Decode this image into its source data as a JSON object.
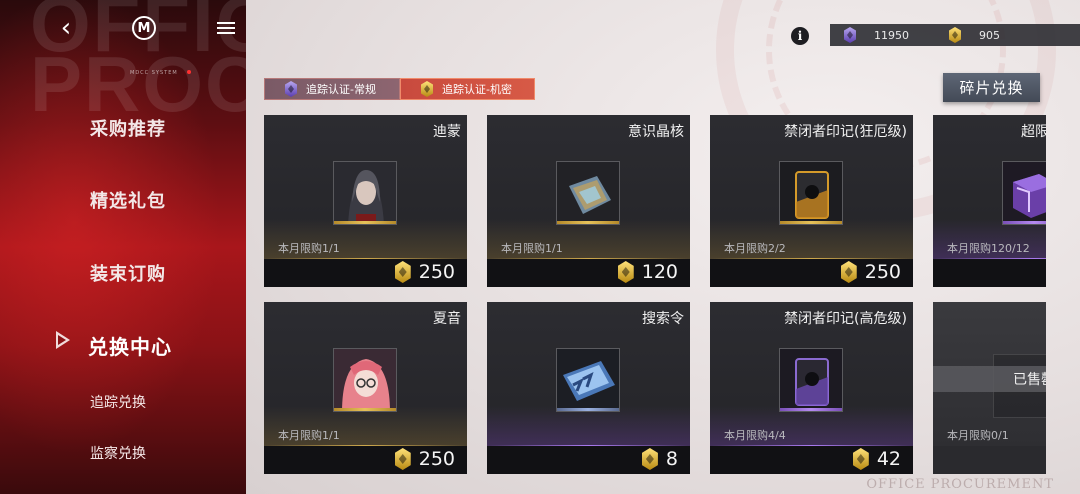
{
  "watermark": {
    "line1": "OFFICE",
    "line2": "PROCUREMENT"
  },
  "left_nav": {
    "items": [
      {
        "label": "采购推荐"
      },
      {
        "label": "精选礼包"
      },
      {
        "label": "装束订购"
      },
      {
        "label": "兑换中心"
      }
    ],
    "sub_items": [
      {
        "label": "追踪兑换"
      },
      {
        "label": "监察兑换"
      }
    ],
    "active": "兑换中心",
    "tiny_label": "MDCC SYSTEM"
  },
  "currency": {
    "purple_amount": "11950",
    "gold_amount": "905"
  },
  "currency_tabs": {
    "regular": "追踪认证-常规",
    "secret": "追踪认证-机密"
  },
  "shard_exchange_button": "碎片兑换",
  "items": [
    {
      "name": "迪蒙",
      "limit": "本月限购1/1",
      "price": "250",
      "rarity": "gold"
    },
    {
      "name": "意识晶核",
      "limit": "本月限购1/1",
      "price": "120",
      "rarity": "gold"
    },
    {
      "name": "禁闭者印记(狂厄级)",
      "limit": "本月限购2/2",
      "price": "250",
      "rarity": "gold"
    },
    {
      "name": "超限",
      "limit": "本月限购120/12",
      "price": "",
      "rarity": "purple"
    },
    {
      "name": "夏音",
      "limit": "本月限购1/1",
      "price": "250",
      "rarity": "gold"
    },
    {
      "name": "搜索令",
      "limit": "",
      "price": "8",
      "rarity": "purple"
    },
    {
      "name": "禁闭者印记(高危级)",
      "limit": "本月限购4/4",
      "price": "42",
      "rarity": "purple"
    },
    {
      "name": "",
      "limit": "本月限购0/1",
      "price": "",
      "rarity": "grey",
      "sold_label": "已售罄"
    }
  ],
  "footer_text": "OFFICE PROCUREMENT"
}
